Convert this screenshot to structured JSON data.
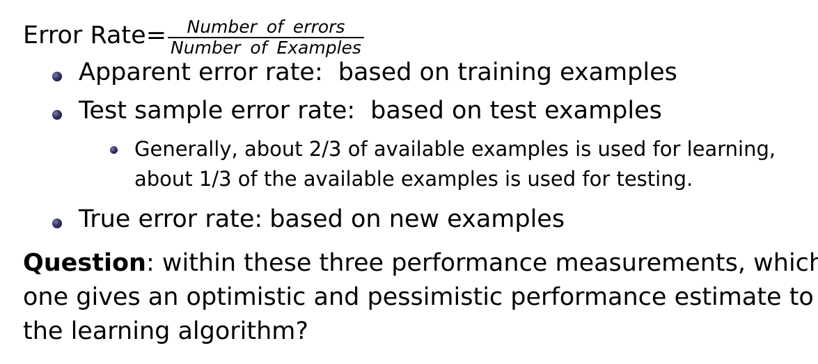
{
  "formula": {
    "lhs": "Error Rate=",
    "numerator": "Number of errors",
    "denominator": "Number of Examples"
  },
  "bullets": [
    {
      "term": "Apparent error rate:",
      "desc": "based on training examples"
    },
    {
      "term": "Test sample error rate:",
      "desc": "based on test examples"
    },
    {
      "term": "True error rate:",
      "desc": "based on new examples"
    }
  ],
  "sub_bullet": {
    "line1": "Generally, about 2/3 of available examples is used for learning,",
    "line2": "about 1/3 of the available examples is used for testing."
  },
  "question": {
    "label": "Question",
    "line1": ": within these three performance measurements, which",
    "line2": "one gives an optimistic and pessimistic performance estimate to",
    "line3": "the learning algorithm?"
  },
  "colors": {
    "text": "#000000",
    "bullet": "#333366",
    "background": "#ffffff"
  }
}
